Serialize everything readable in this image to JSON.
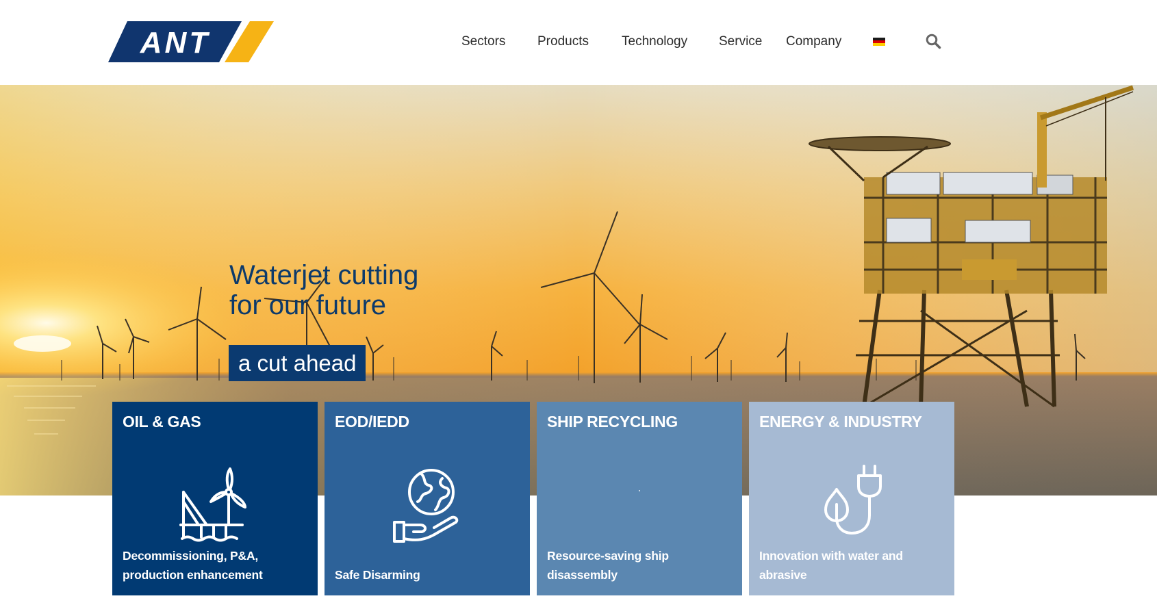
{
  "brand": {
    "logo_text": "ANT",
    "navy": "#10356e",
    "yellow": "#f6b315"
  },
  "nav": {
    "items": [
      {
        "label": "Sectors"
      },
      {
        "label": "Products"
      },
      {
        "label": "Technology"
      },
      {
        "label": "Service"
      },
      {
        "label": "Company"
      }
    ],
    "language_icon": "german-flag-icon",
    "search_icon": "search-icon"
  },
  "hero": {
    "title_line1": "Waterjet cutting",
    "title_line2": "for our future",
    "tagline": "a cut ahead"
  },
  "sectors": [
    {
      "title": "OIL & GAS",
      "description": "Decommissioning, P&A, production enhancement",
      "icon": "offshore-platform-wind-icon",
      "color": "#013a73"
    },
    {
      "title": "EOD/IEDD",
      "description": "Safe Disarming",
      "icon": "globe-in-hand-icon",
      "color": "#2d6299"
    },
    {
      "title": "SHIP RECYCLING",
      "description": "Resource-saving ship disassembly",
      "icon": "ship-icon",
      "color": "#5b87b1"
    },
    {
      "title": "ENERGY & INDUSTRY",
      "description": "Innovation with water and abrasive",
      "icon": "water-drop-plug-icon",
      "color": "#a6bad3"
    }
  ]
}
